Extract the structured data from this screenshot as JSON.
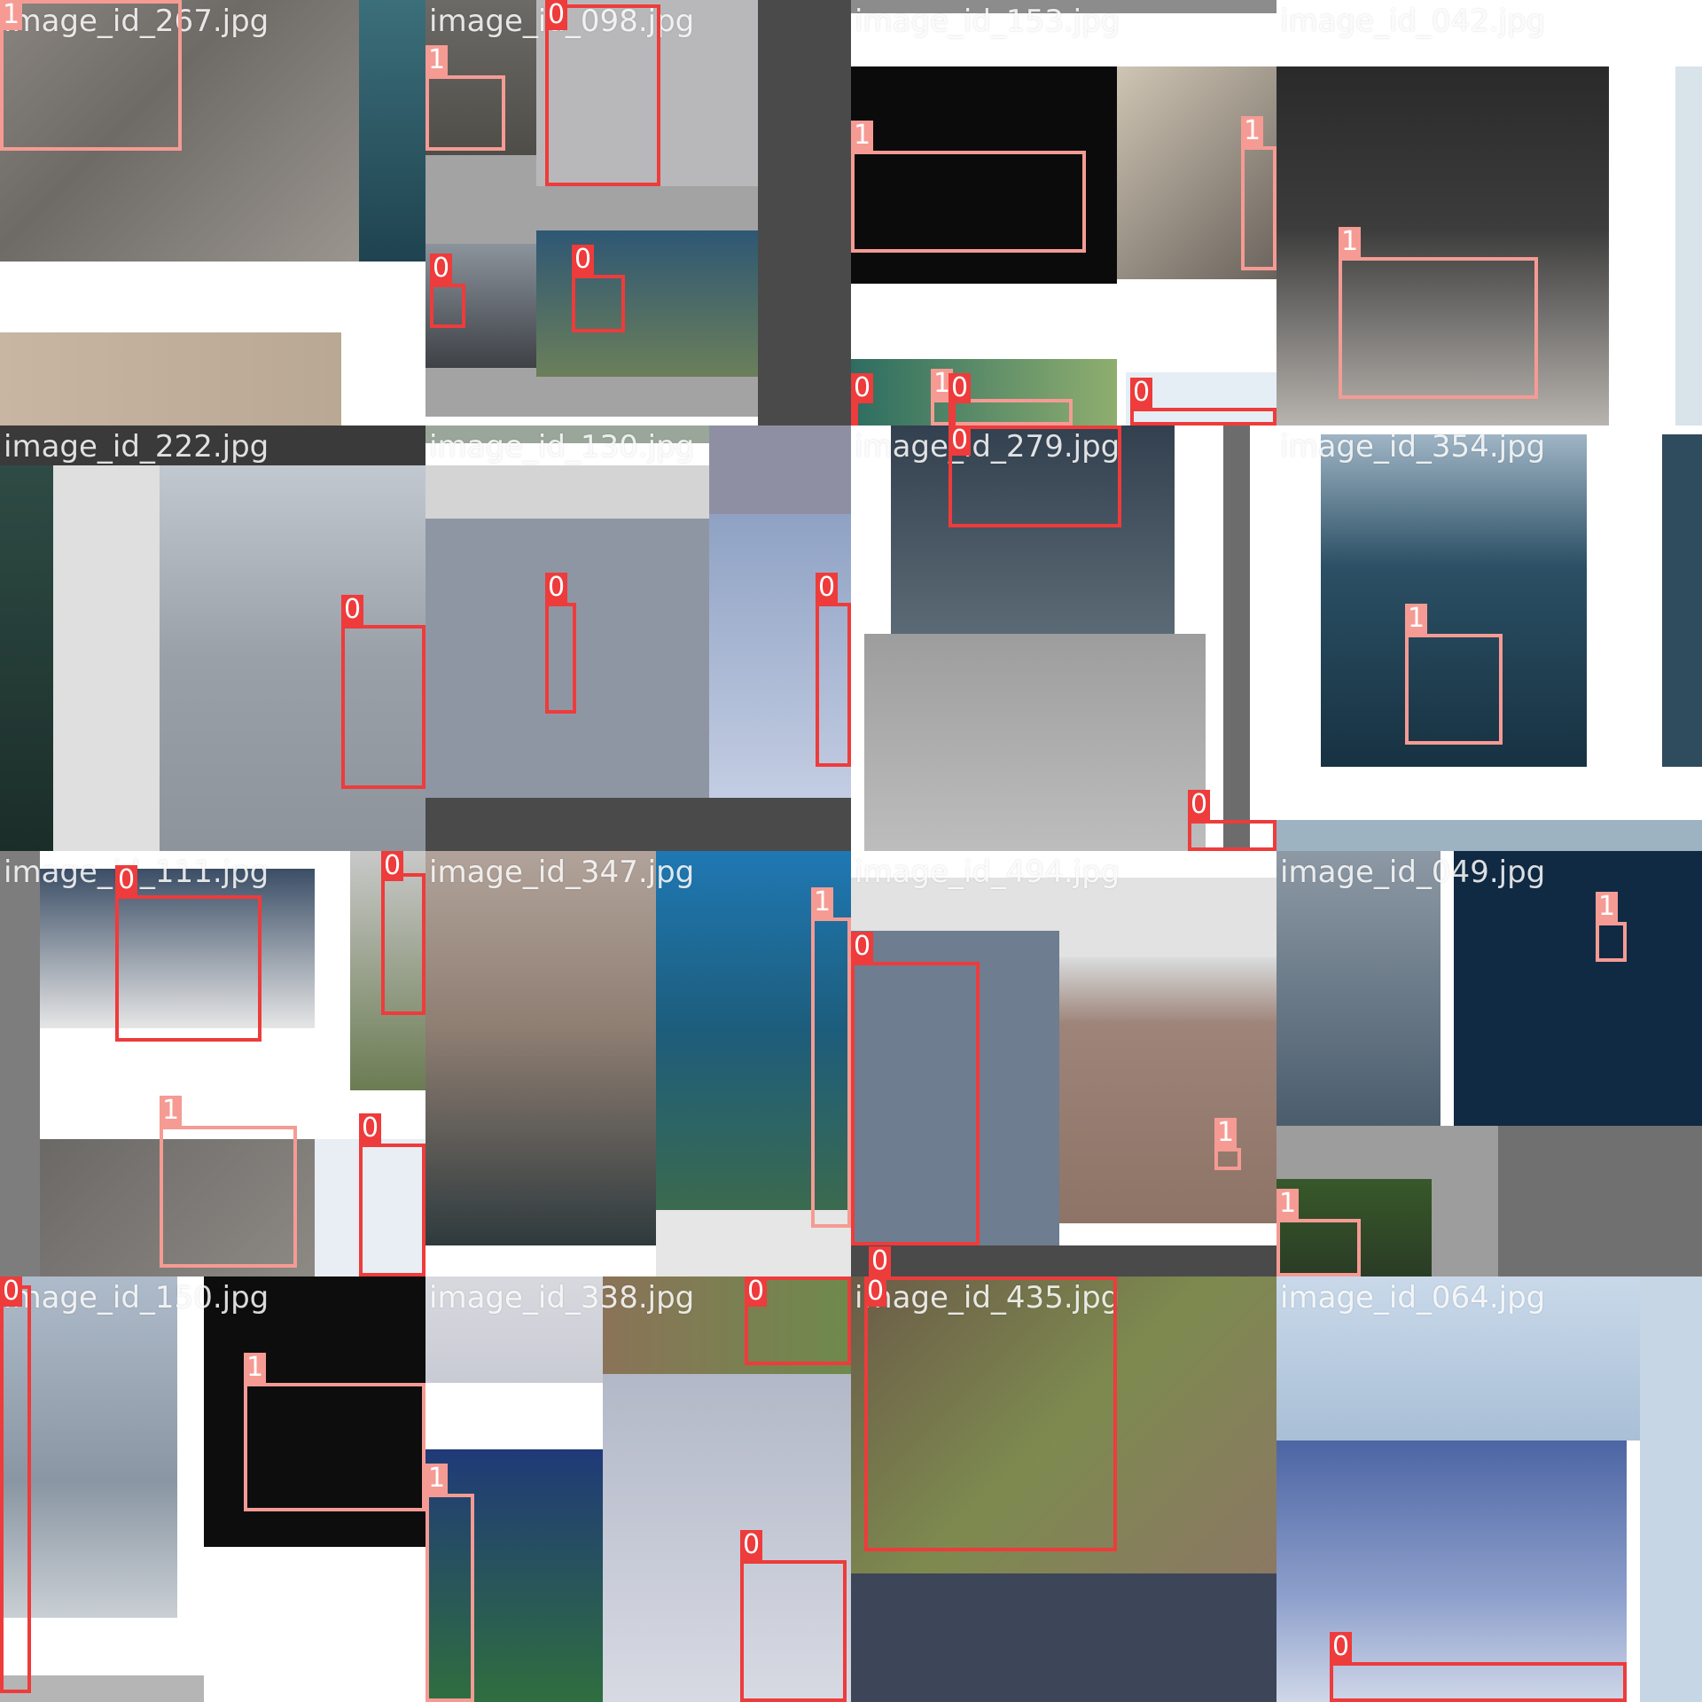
{
  "class_colors": {
    "0": "#ee3b3b",
    "1": "#f59b94"
  },
  "tiles": [
    {
      "filename": "image_id_267.jpg",
      "labels": [
        "1"
      ]
    },
    {
      "filename": "image_id_098.jpg",
      "labels": [
        "0",
        "1",
        "0",
        "0"
      ]
    },
    {
      "filename": "image_id_153.jpg",
      "labels": [
        "1",
        "1",
        "1",
        "0",
        "0",
        "0"
      ]
    },
    {
      "filename": "image_id_042.jpg",
      "labels": [
        "1"
      ]
    },
    {
      "filename": "image_id_222.jpg",
      "labels": [
        "0"
      ]
    },
    {
      "filename": "image_id_130.jpg",
      "labels": [
        "0",
        "0"
      ]
    },
    {
      "filename": "image_id_279.jpg",
      "labels": [
        "0",
        "0"
      ]
    },
    {
      "filename": "image_id_354.jpg",
      "labels": [
        "1"
      ]
    },
    {
      "filename": "image_id_111.jpg",
      "labels": [
        "0",
        "0",
        "1",
        "0"
      ]
    },
    {
      "filename": "image_id_347.jpg",
      "labels": [
        "1"
      ]
    },
    {
      "filename": "image_id_494.jpg",
      "labels": [
        "0",
        "1",
        "0"
      ]
    },
    {
      "filename": "image_id_049.jpg",
      "labels": [
        "1",
        "1"
      ]
    },
    {
      "filename": "image_id_150.jpg",
      "labels": [
        "0",
        "1"
      ]
    },
    {
      "filename": "image_id_338.jpg",
      "labels": [
        "0",
        "1",
        "0"
      ]
    },
    {
      "filename": "image_id_435.jpg",
      "labels": [
        "0"
      ]
    },
    {
      "filename": "image_id_064.jpg",
      "labels": [
        "0"
      ]
    }
  ]
}
